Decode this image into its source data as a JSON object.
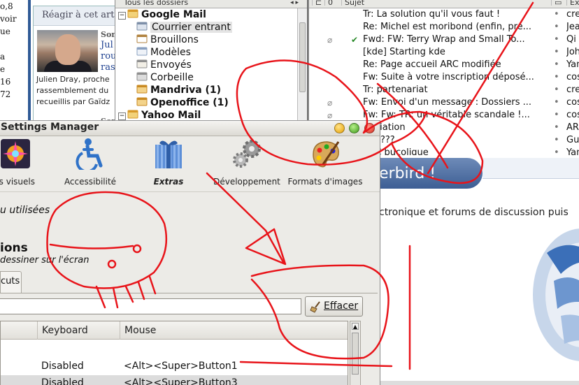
{
  "webpage": {
    "left_col_lines": [
      "o,8",
      "voir",
      "ue",
      "",
      "a",
      "e",
      "16",
      "72"
    ],
    "box_header": "Réagir à cet artic",
    "sommaire": "Son",
    "article_link_lines": [
      "Jul",
      "rou",
      "ras"
    ],
    "caption_lines": [
      "Julien Dray, proche",
      "rassemblement du",
      "recueillis par Gaïdz"
    ],
    "sommaire2": "Son"
  },
  "folders": {
    "header": "Tous les dossiers",
    "items": [
      {
        "label": "Google Mail",
        "bold": true,
        "expander": "−",
        "icon": "account-icon",
        "indent": 0
      },
      {
        "label": "Courrier entrant",
        "bold": false,
        "selected": true,
        "icon": "inbox-icon",
        "indent": 1
      },
      {
        "label": "Brouillons",
        "bold": false,
        "icon": "drafts-icon",
        "indent": 1
      },
      {
        "label": "Modèles",
        "bold": false,
        "icon": "templates-icon",
        "indent": 1
      },
      {
        "label": "Envoyés",
        "bold": false,
        "icon": "sent-icon",
        "indent": 1
      },
      {
        "label": "Corbeille",
        "bold": false,
        "icon": "trash-icon",
        "indent": 1
      },
      {
        "label": "Mandriva (1)",
        "bold": true,
        "icon": "folder-new-icon",
        "indent": 1
      },
      {
        "label": "Openoffice (1)",
        "bold": true,
        "icon": "folder-new-icon",
        "indent": 1
      },
      {
        "label": "Yahoo Mail",
        "bold": true,
        "expander": "−",
        "icon": "account-icon",
        "indent": 0
      }
    ]
  },
  "messages": {
    "columns": [
      "Sujet",
      "Ex"
    ],
    "rows": [
      {
        "subject": "Tr: La solution qu'il vous faut !",
        "from": "cre",
        "attach": false,
        "thread": false
      },
      {
        "subject": "Re: Michel est moribond (enfin, pre...",
        "from": "Jea",
        "attach": false,
        "thread": false
      },
      {
        "subject": "Fwd: FW: Terry Wrap and Small To...",
        "from": "Qi",
        "attach": true,
        "thread": true
      },
      {
        "subject": "[kde] Starting kde",
        "from": "Joh",
        "attach": false,
        "thread": false
      },
      {
        "subject": "Re: Page accueil ARC modifiée",
        "from": "Yan",
        "attach": false,
        "thread": false
      },
      {
        "subject": "Fw: Suite à votre inscription déposé...",
        "from": "cos",
        "attach": false,
        "thread": false
      },
      {
        "subject": "Tr: partenariat",
        "from": "cre",
        "attach": false,
        "thread": false
      },
      {
        "subject": "Fw: Envoi d'un message : Dossiers ...",
        "from": "cos",
        "attach": true,
        "thread": false
      },
      {
        "subject": "Fw: Fw: TR: un véritable scandale !...",
        "from": "cos",
        "attach": true,
        "thread": false
      },
      {
        "subject": "affiliation",
        "from": "ARC",
        "attach": false,
        "thread": false
      },
      {
        "subject": "Re: ???",
        "from": "Gu",
        "attach": false,
        "thread": false
      },
      {
        "subject": "ARC bucolique",
        "from": "Yan",
        "attach": false,
        "thread": false
      }
    ]
  },
  "startpage": {
    "banner": "erbird !",
    "description": "ctronique et forums de discussion puis"
  },
  "settings": {
    "title": "Settings Manager",
    "toolbar": [
      {
        "label": "ts visuels",
        "icon": "visual-effects-icon",
        "active": false
      },
      {
        "label": "Accessibilité",
        "icon": "accessibility-icon",
        "active": false
      },
      {
        "label": "Extras",
        "icon": "extras-gift-icon",
        "active": true
      },
      {
        "label": "Développement",
        "icon": "development-gears-icon",
        "active": false
      },
      {
        "label": "Formats d'images",
        "icon": "image-formats-palette-icon",
        "active": false
      }
    ],
    "hint": "u utilisées",
    "section_title": "ions",
    "section_subtitle": "dessiner sur l'écran",
    "tab_label": "cuts",
    "clear_button": "Effacer",
    "table": {
      "headers": [
        "Keyboard",
        "Mouse"
      ],
      "rows": [
        {
          "name": "",
          "keyboard": "",
          "mouse": ""
        },
        {
          "name": "",
          "keyboard": "Disabled",
          "mouse": "<Alt><Super>Button1"
        },
        {
          "name": "",
          "keyboard": "Disabled",
          "mouse": "<Alt><Super>Button3"
        }
      ]
    }
  },
  "colors": {
    "scribble": "#e8141a",
    "banner": "#4a6ba1",
    "link": "#1c3f8f"
  }
}
